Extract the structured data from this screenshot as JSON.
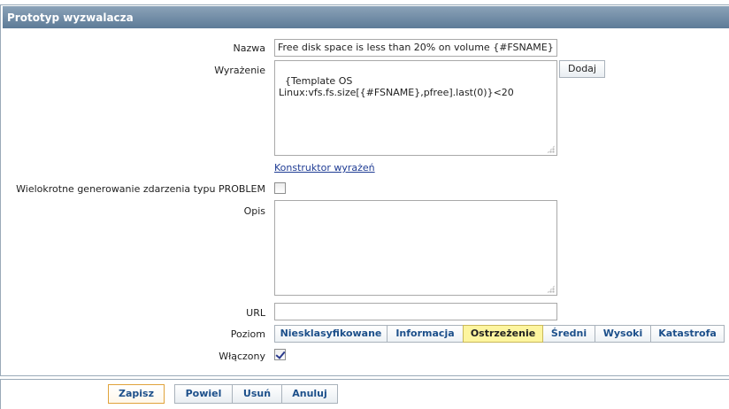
{
  "panel": {
    "title": "Prototyp wyzwalacza"
  },
  "form": {
    "name": {
      "label": "Nazwa",
      "value": "Free disk space is less than 20% on volume {#FSNAME}"
    },
    "expression": {
      "label": "Wyrażenie",
      "value": "{Template OS\nLinux:vfs.fs.size[{#FSNAME},pfree].last(0)}<20",
      "add_button": "Dodaj",
      "constructor_link": "Konstruktor wyrażeń"
    },
    "multiple_events": {
      "label": "Wielokrotne generowanie zdarzenia typu PROBLEM",
      "checked": false
    },
    "description": {
      "label": "Opis",
      "value": ""
    },
    "url": {
      "label": "URL",
      "value": ""
    },
    "severity": {
      "label": "Poziom",
      "options": [
        "Niesklasyfikowane",
        "Informacja",
        "Ostrzeżenie",
        "Średni",
        "Wysoki",
        "Katastrofa"
      ],
      "selected": "Ostrzeżenie"
    },
    "enabled": {
      "label": "Włączony",
      "checked": true
    }
  },
  "footer": {
    "save": "Zapisz",
    "clone": "Powiel",
    "delete": "Usuń",
    "cancel": "Anuluj"
  },
  "colors": {
    "header_gradient_top": "#8ba2b8",
    "header_gradient_bottom": "#5d7b97",
    "selected_severity_bg": "#fdf59f",
    "link": "#1f3c94"
  }
}
